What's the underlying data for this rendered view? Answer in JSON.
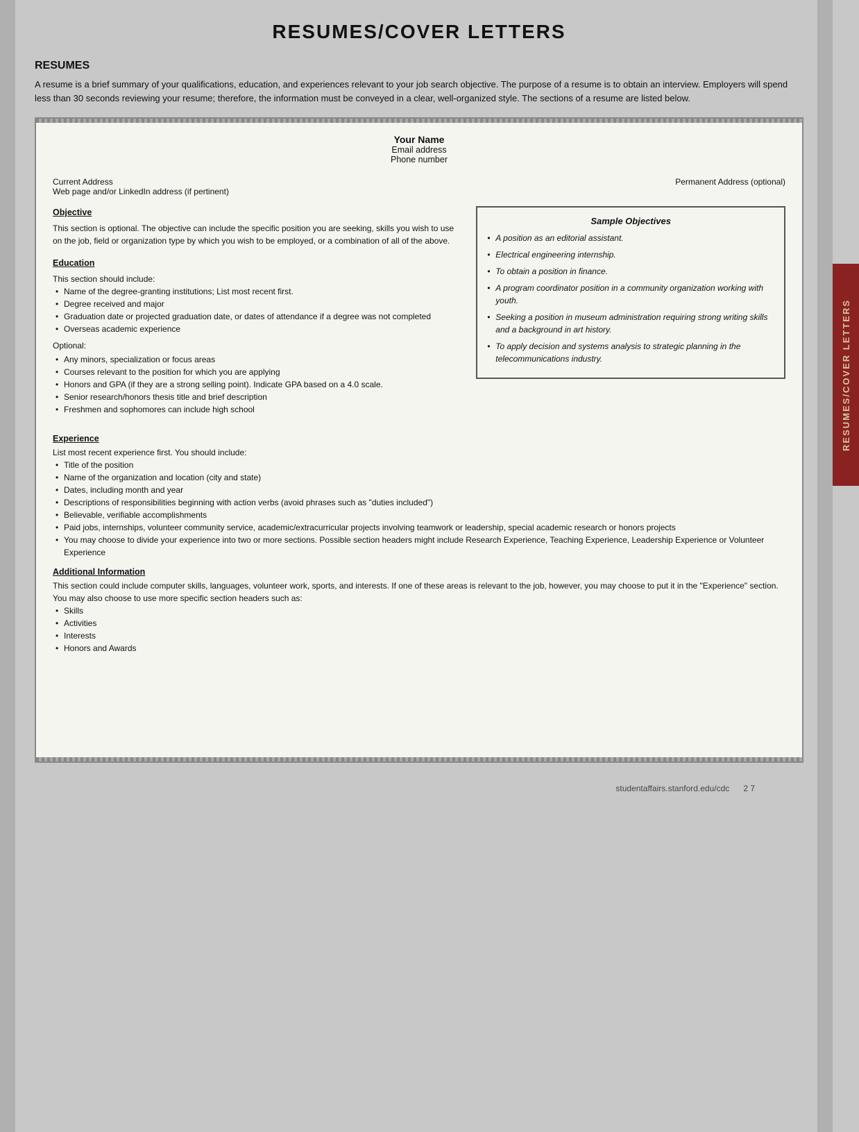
{
  "page": {
    "title": "RESUMES/COVER LETTERS",
    "footer_url": "studentaffairs.stanford.edu/cdc",
    "footer_page": "2  7"
  },
  "side_tab": {
    "label": "RESUMES/COVER LETTERS"
  },
  "resumes_section": {
    "heading": "RESUMES",
    "intro": "A resume is a brief summary of your qualifications, education, and experiences relevant to your job search objective. The purpose of a resume is to obtain an interview. Employers will spend less than 30 seconds reviewing your resume; therefore, the information must be conveyed in a clear, well-organized style. The sections of a resume are listed below."
  },
  "resume_template": {
    "name": "Your Name",
    "email": "Email address",
    "phone": "Phone number",
    "current_address": "Current Address",
    "web_address": "Web page and/or LinkedIn address (if pertinent)",
    "permanent_address": "Permanent Address (optional)"
  },
  "objective_section": {
    "label": "Objective",
    "text": "This section is optional. The objective can include the specific position you are seeking, skills you wish to use on the job, field or organization type by which you wish to be employed, or a combination of all of the above."
  },
  "sample_objectives": {
    "title": "Sample Objectives",
    "items": [
      "A position as an editorial assistant.",
      "Electrical engineering internship.",
      "To obtain a position in finance.",
      "A program coordinator position in a community organization working with youth.",
      "Seeking a position in museum administration requiring strong writing skills and a background in art history.",
      "To apply decision and systems analysis to strategic planning in the telecommunications industry."
    ]
  },
  "education_section": {
    "label": "Education",
    "intro": "This section should include:",
    "items": [
      "Name of the degree-granting institutions; List most recent first.",
      "Degree received and major",
      "Graduation date or projected graduation date, or dates of attendance if a degree was not completed",
      "Overseas academic experience"
    ],
    "optional_label": "Optional:",
    "optional_items": [
      "Any minors, specialization or focus areas",
      "Courses relevant to the position for which you are applying",
      "Honors and GPA (if they are a strong selling point). Indicate GPA based on a 4.0 scale.",
      "Senior research/honors thesis title and brief description",
      "Freshmen and sophomores can include high school"
    ]
  },
  "experience_section": {
    "label": "Experience",
    "intro": "List most recent experience first. You should include:",
    "items": [
      "Title of the position",
      "Name of the organization and location (city and state)",
      "Dates, including month and year",
      "Descriptions of responsibilities beginning with action verbs (avoid phrases such as \"duties included\")",
      "Believable, verifiable accomplishments",
      "Paid jobs, internships, volunteer community service, academic/extracurricular projects involving teamwork or leadership, special academic research or honors projects",
      "You may choose to divide your experience into two or more sections. Possible section headers might include Research Experience, Teaching Experience, Leadership Experience or Volunteer Experience"
    ]
  },
  "additional_section": {
    "label": "Additional Information",
    "intro": "This section could include computer skills, languages, volunteer work, sports, and interests. If one of these areas is relevant to the job, however, you may choose to put it in the \"Experience\" section. You may also choose to use more specific section headers such as:",
    "items": [
      "Skills",
      "Activities",
      "Interests",
      "Honors and Awards"
    ]
  }
}
